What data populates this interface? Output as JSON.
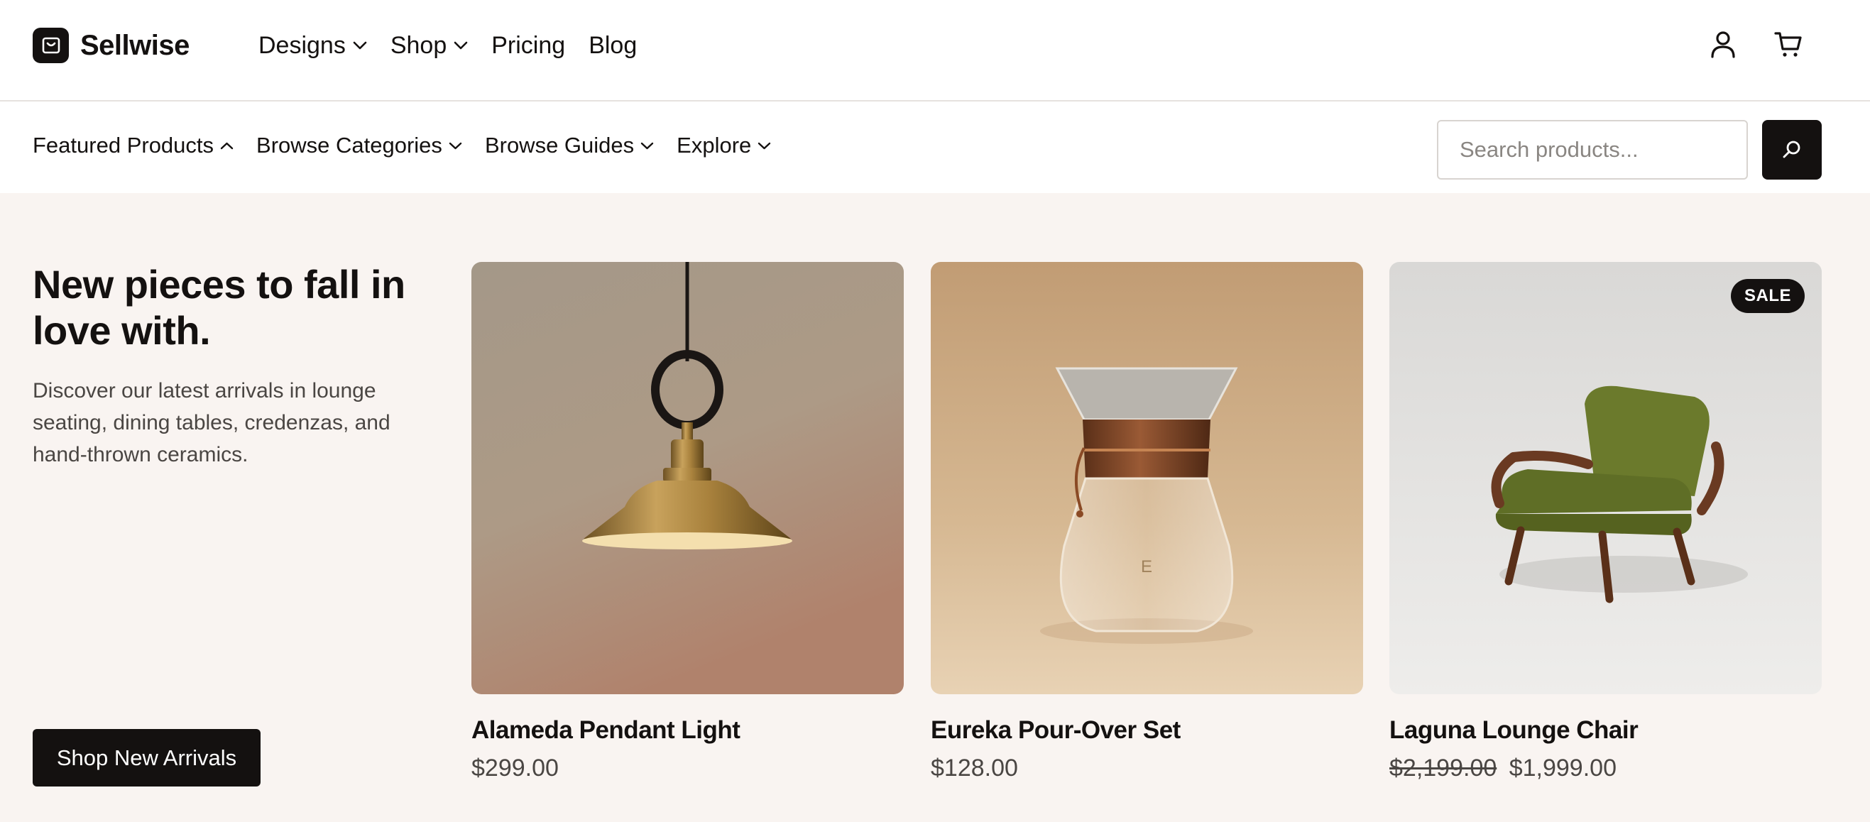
{
  "brand": {
    "name": "Sellwise"
  },
  "primary_nav": {
    "items": [
      {
        "label": "Designs",
        "has_dropdown": true
      },
      {
        "label": "Shop",
        "has_dropdown": true
      },
      {
        "label": "Pricing",
        "has_dropdown": false
      },
      {
        "label": "Blog",
        "has_dropdown": false
      }
    ]
  },
  "header_icons": [
    "account-icon",
    "cart-icon"
  ],
  "sub_nav": {
    "items": [
      {
        "label": "Featured Products",
        "expanded": true
      },
      {
        "label": "Browse Categories",
        "expanded": false
      },
      {
        "label": "Browse Guides",
        "expanded": false
      },
      {
        "label": "Explore",
        "expanded": false
      }
    ],
    "search": {
      "placeholder": "Search products...",
      "value": ""
    }
  },
  "hero": {
    "title": "New pieces to fall in love with.",
    "description": "Discover our latest arrivals in lounge seating, dining tables, credenzas, and hand-thrown ceramics.",
    "cta_label": "Shop New Arrivals"
  },
  "products": [
    {
      "name": "Alameda Pendant Light",
      "price": "$299.00"
    },
    {
      "name": "Eureka Pour-Over Set",
      "price": "$128.00"
    },
    {
      "name": "Laguna Lounge Chair",
      "old_price": "$2,199.00",
      "price": "$1,999.00",
      "badge": "SALE"
    }
  ],
  "colors": {
    "primary": "#141110",
    "hero_background": "#f9f4f1",
    "muted_text": "#4a4643"
  }
}
